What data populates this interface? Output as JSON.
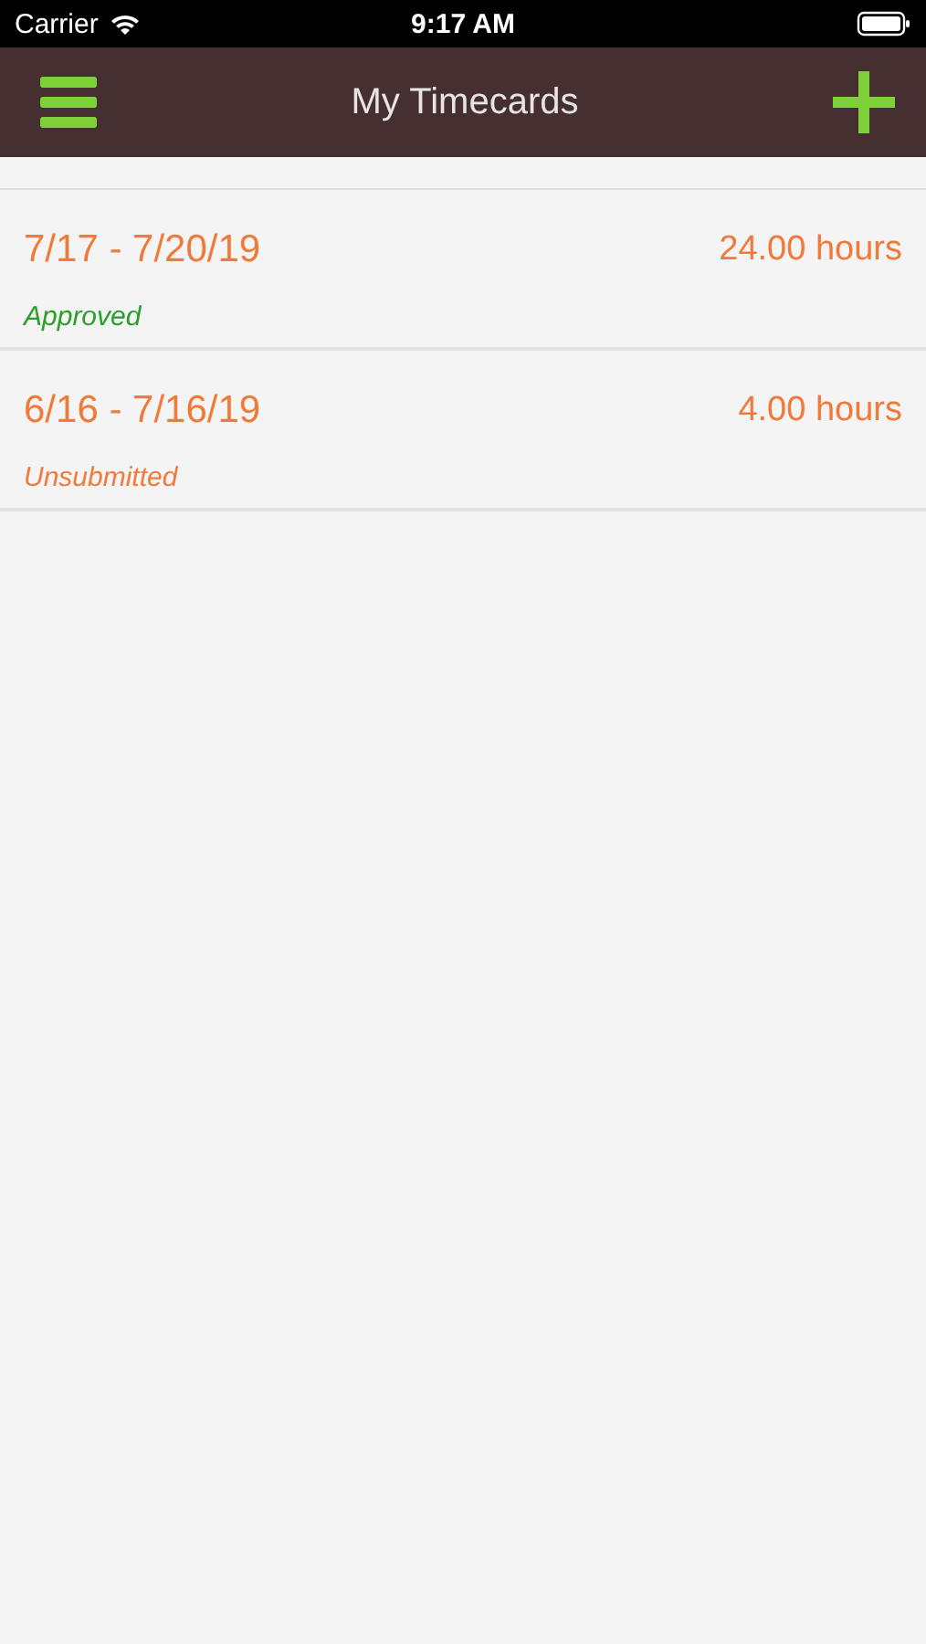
{
  "status_bar": {
    "carrier": "Carrier",
    "time": "9:17 AM"
  },
  "nav_bar": {
    "title": "My Timecards"
  },
  "timecards": [
    {
      "period": "7/17 - 7/20/19",
      "hours": "24.00 hours",
      "status": "Approved",
      "color": "#2aa02a"
    },
    {
      "period": "6/16 - 7/16/19",
      "hours": "4.00 hours",
      "status": "Unsubmitted",
      "color": "#f07a3a"
    }
  ]
}
